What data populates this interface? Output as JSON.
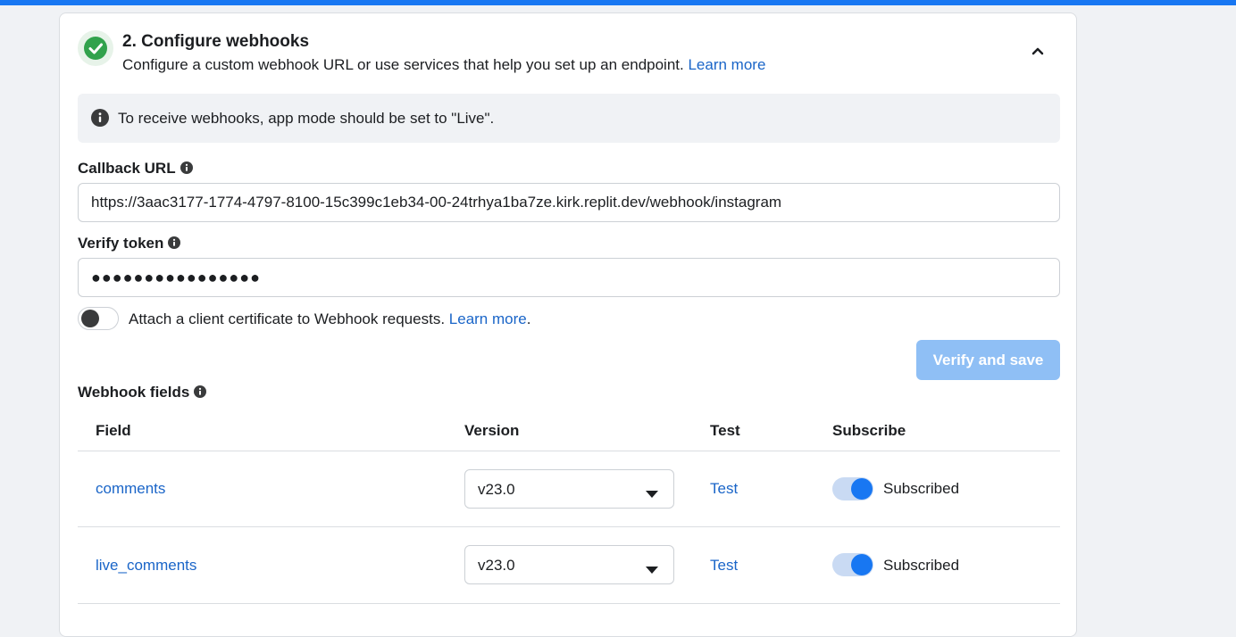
{
  "colors": {
    "accent": "#1877f2",
    "link": "#1a65c8",
    "success": "#31a24c",
    "button_disabled": "#8fbff5"
  },
  "step": {
    "title": "2. Configure webhooks",
    "description": "Configure a custom webhook URL or use services that help you set up an endpoint.",
    "learn_more": "Learn more",
    "status_icon": "check-circle-icon",
    "collapse_icon": "chevron-up-icon"
  },
  "notice": {
    "icon": "info-icon",
    "text": "To receive webhooks, app mode should be set to \"Live\"."
  },
  "callback_url": {
    "label": "Callback URL",
    "value": "https://3aac3177-1774-4797-8100-15c399c1eb34-00-24trhya1ba7ze.kirk.replit.dev/webhook/instagram"
  },
  "verify_token": {
    "label": "Verify token",
    "value": "●●●●●●●●●●●●●●●●"
  },
  "client_cert": {
    "enabled": false,
    "text": "Attach a client certificate to Webhook requests.",
    "learn_more": "Learn more",
    "suffix": "."
  },
  "verify_button": {
    "label": "Verify and save",
    "enabled": false
  },
  "webhook_fields": {
    "label": "Webhook fields",
    "columns": [
      "Field",
      "Version",
      "Test",
      "Subscribe"
    ],
    "rows": [
      {
        "field": "comments",
        "version": "v23.0",
        "test": "Test",
        "subscribed": true,
        "subscribe_label": "Subscribed"
      },
      {
        "field": "live_comments",
        "version": "v23.0",
        "test": "Test",
        "subscribed": true,
        "subscribe_label": "Subscribed"
      }
    ]
  }
}
